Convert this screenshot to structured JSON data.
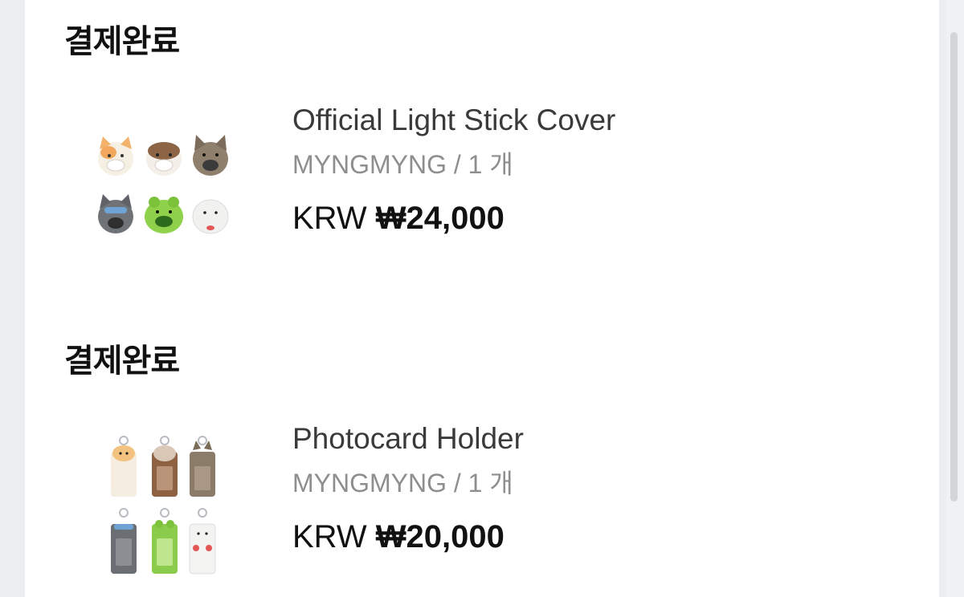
{
  "orders": [
    {
      "status": "결제완료",
      "product_name": "Official Light Stick Cover",
      "option": "MYNGMYNG",
      "separator": "/",
      "quantity": "1 개",
      "currency": "KRW",
      "price": "₩24,000",
      "thumbnail_icon": "light-stick-cover-set-image"
    },
    {
      "status": "결제완료",
      "product_name": "Photocard Holder",
      "option": "MYNGMYNG",
      "separator": "/",
      "quantity": "1 개",
      "currency": "KRW",
      "price": "₩20,000",
      "thumbnail_icon": "photocard-holder-set-image"
    }
  ],
  "colors": {
    "background": "#eceef0",
    "panel": "#ffffff",
    "status_text": "#111111",
    "name_text": "#3a3a3a",
    "meta_text": "#8e8e8e"
  }
}
